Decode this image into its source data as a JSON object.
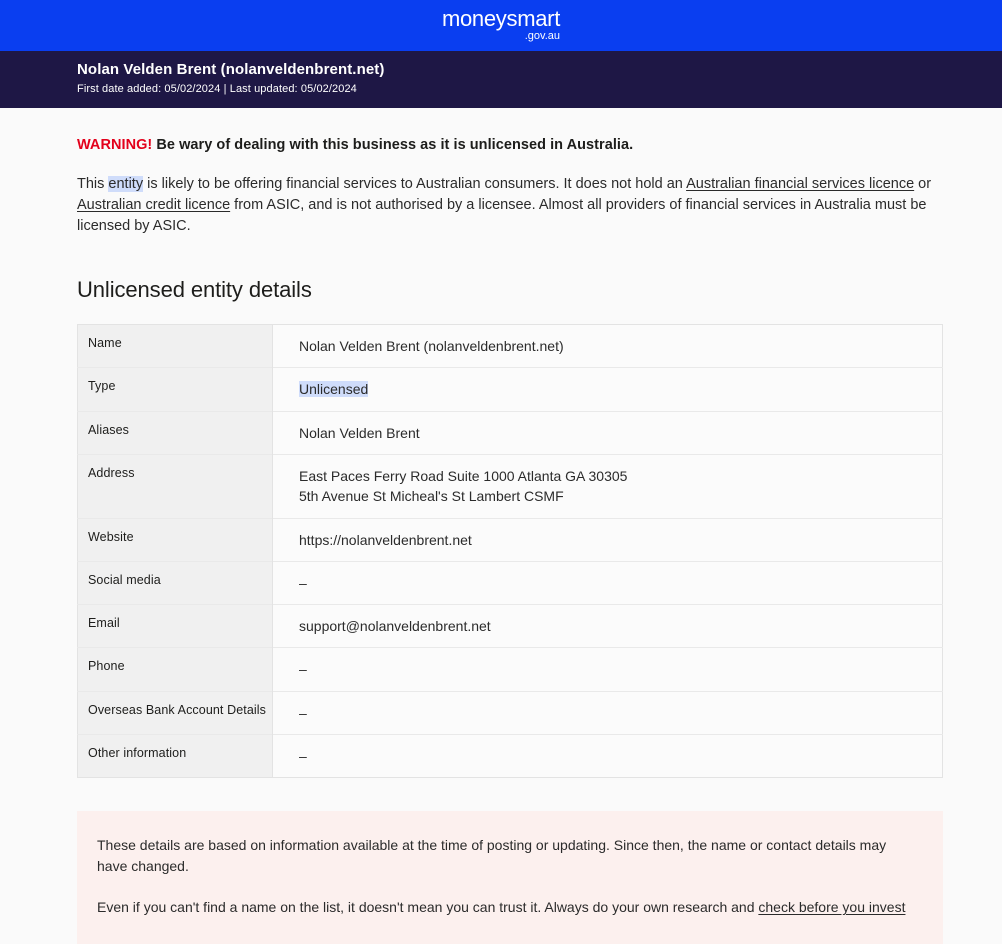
{
  "brand": {
    "name": "moneysmart",
    "domain": ".gov.au",
    "bar_color": "#0a3ef0"
  },
  "entity_banner": {
    "title": "Nolan Velden Brent (nolanveldenbrent.net)",
    "dates": "First date added: 05/02/2024 | Last updated: 05/02/2024",
    "background_color": "#1e1745"
  },
  "warning": {
    "label": "WARNING!",
    "label_color": "#e3001b",
    "text": " Be wary of dealing with this business as it is unlicensed in Australia."
  },
  "intro": {
    "part1": "This ",
    "highlight": "entity",
    "part2": " is likely to be offering financial services to Australian consumers. It does not hold an ",
    "link1": "Australian financial services licence",
    "part3": " or ",
    "link2": "Australian credit licence",
    "part4": " from ASIC, and is not authorised by a licensee. Almost all providers of financial services in Australia must be licensed by ASIC.",
    "highlight_color": "#cfdcfa"
  },
  "details": {
    "heading": "Unlicensed entity details",
    "rows": [
      {
        "label": "Name",
        "value": "Nolan Velden Brent (nolanveldenbrent.net)",
        "value2": "",
        "highlighted": false
      },
      {
        "label": "Type",
        "value": "Unlicensed",
        "value2": "",
        "highlighted": true
      },
      {
        "label": "Aliases",
        "value": "Nolan Velden Brent",
        "value2": "",
        "highlighted": false
      },
      {
        "label": "Address",
        "value": "East Paces Ferry Road Suite 1000 Atlanta GA 30305",
        "value2": "5th Avenue St Micheal's St Lambert CSMF",
        "highlighted": false
      },
      {
        "label": "Website",
        "value": "https://nolanveldenbrent.net",
        "value2": "",
        "highlighted": false
      },
      {
        "label": "Social media",
        "value": "–",
        "value2": "",
        "highlighted": false
      },
      {
        "label": "Email",
        "value": "support@nolanveldenbrent.net",
        "value2": "",
        "highlighted": false
      },
      {
        "label": "Phone",
        "value": "–",
        "value2": "",
        "highlighted": false
      },
      {
        "label": "Overseas Bank Account Details",
        "value": "–",
        "value2": "",
        "highlighted": false
      },
      {
        "label": "Other information",
        "value": "–",
        "value2": "",
        "highlighted": false
      }
    ]
  },
  "disclaimer": {
    "background_color": "#fcf0ee",
    "paragraph1": "These details are based on information available at the time of posting or updating. Since then, the name or contact details may have changed.",
    "paragraph2_before": "Even if you can't find a name on the list, it doesn't mean you can trust it. Always do your own research and ",
    "paragraph2_link": "check before you invest"
  }
}
